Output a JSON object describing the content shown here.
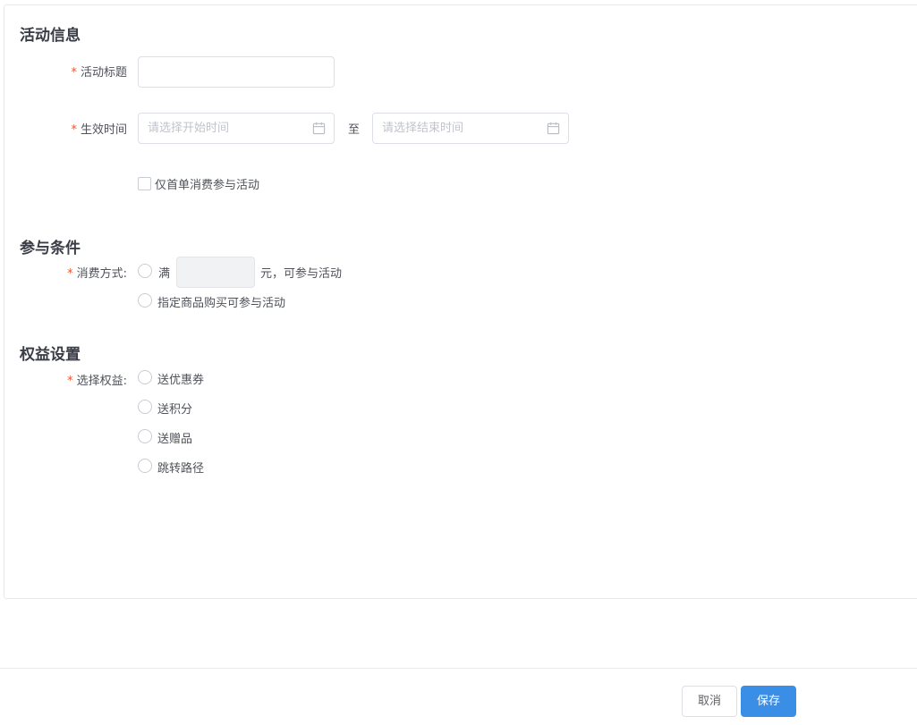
{
  "sections": {
    "activity_info": "活动信息",
    "conditions": "参与条件",
    "benefits": "权益设置"
  },
  "activity_info": {
    "required_mark": "*",
    "title_label": "活动标题",
    "title_value": "",
    "effective_label": "生效时间",
    "start_placeholder": "请选择开始时间",
    "range_separator": "至",
    "end_placeholder": "请选择结束时间",
    "first_order_only": "仅首单消费参与活动"
  },
  "conditions": {
    "required_mark": "*",
    "method_label": "消费方式:",
    "full_prefix": "满",
    "amount_value": "",
    "full_suffix": "元，可参与活动",
    "specified_goods": "指定商品购买可参与活动"
  },
  "benefits": {
    "required_mark": "*",
    "select_label": "选择权益:",
    "options": [
      "送优惠券",
      "送积分",
      "送赠品",
      "跳转路径"
    ]
  },
  "footer": {
    "cancel": "取消",
    "save": "保存"
  },
  "colors": {
    "primary": "#3a8ee6",
    "required": "#f0532e"
  }
}
